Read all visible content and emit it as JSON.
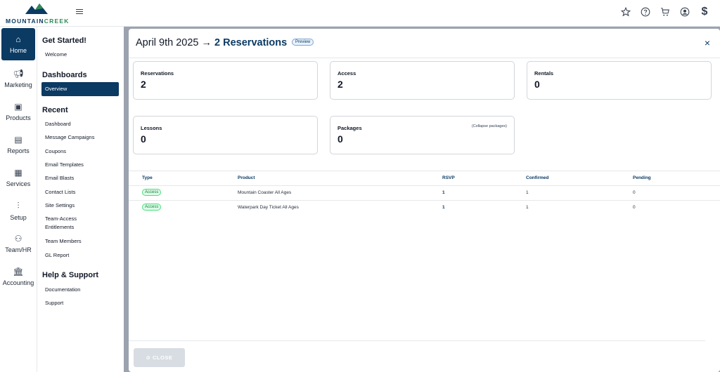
{
  "brand": {
    "name_part1": "MOUNTAIN",
    "name_part2": "CREEK"
  },
  "topbar": {
    "icons": [
      "star-icon",
      "help-icon",
      "cart-icon",
      "user-icon",
      "dollar-icon"
    ],
    "dollar_label": "$"
  },
  "rail": {
    "items": [
      {
        "label": "Home",
        "icon": "home-icon"
      },
      {
        "label": "Marketing",
        "icon": "megaphone-icon"
      },
      {
        "label": "Products",
        "icon": "briefcase-icon"
      },
      {
        "label": "Reports",
        "icon": "clipboard-icon"
      },
      {
        "label": "Services",
        "icon": "id-card-icon"
      },
      {
        "label": "Setup",
        "icon": "sliders-icon"
      },
      {
        "label": "Team/HR",
        "icon": "team-icon"
      },
      {
        "label": "Accounting",
        "icon": "bank-icon"
      }
    ]
  },
  "menu": {
    "get_started": {
      "heading": "Get Started!",
      "items": [
        "Welcome"
      ]
    },
    "dashboards": {
      "heading": "Dashboards",
      "items": [
        "Overview"
      ]
    },
    "recent": {
      "heading": "Recent",
      "items": [
        "Dashboard",
        "Message Campaigns",
        "Coupons",
        "Email Templates",
        "Email Blasts",
        "Contact Lists",
        "Site Settings",
        "Team-Access",
        "Entitlements",
        "Team Members",
        "GL Report"
      ]
    },
    "help": {
      "heading": "Help & Support",
      "items": [
        "Documentation",
        "Support"
      ]
    }
  },
  "modal": {
    "date": "April 9th 2025 →",
    "reservations_title": "2 Reservations",
    "preview_badge": "Preview",
    "close_icon": "×",
    "cards": [
      {
        "label": "Reservations",
        "value": "2"
      },
      {
        "label": "Access",
        "value": "2"
      },
      {
        "label": "Rentals",
        "value": "0"
      },
      {
        "label": "Lessons",
        "value": "0"
      },
      {
        "label": "Packages",
        "value": "0",
        "extra": "(Collapse packages)"
      }
    ],
    "table": {
      "headers": [
        "Type",
        "Product",
        "RSVP",
        "Confirmed",
        "Pending"
      ],
      "rows": [
        {
          "type": "Access",
          "product": "Mountain Coaster All Ages",
          "rsvp": "1",
          "confirmed": "1",
          "pending": "0"
        },
        {
          "type": "Access",
          "product": "Waterpark Day Ticket All Ages",
          "rsvp": "1",
          "confirmed": "1",
          "pending": "0"
        }
      ]
    },
    "close_button": "⊘ CLOSE"
  }
}
